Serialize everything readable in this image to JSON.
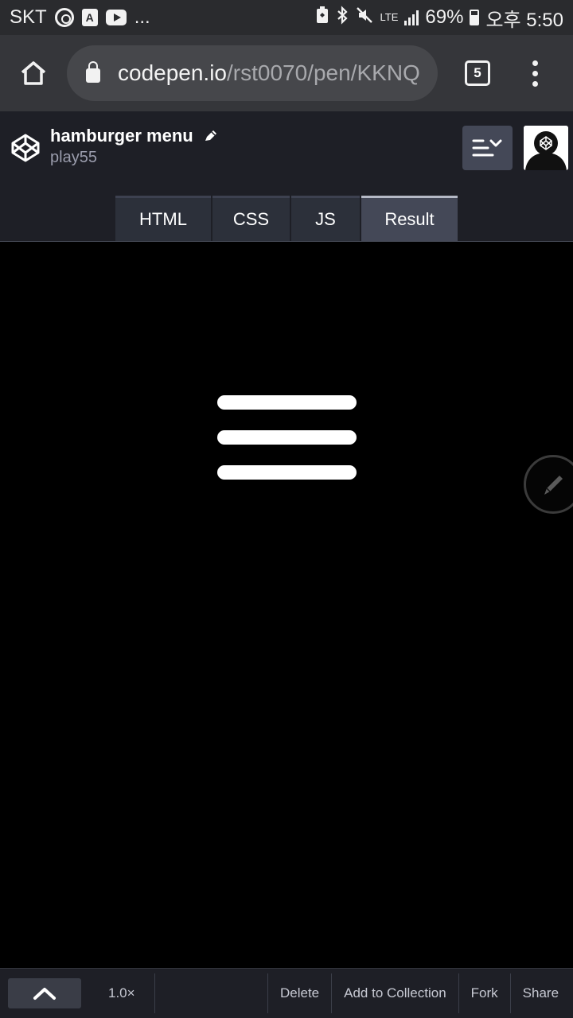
{
  "status_bar": {
    "carrier": "SKT",
    "more": "...",
    "network": "LTE",
    "battery": "69%",
    "time": "오후 5:50"
  },
  "browser": {
    "url_domain": "codepen.io",
    "url_path": "/rst0070/pen/KKNQ",
    "tab_count": "5"
  },
  "pen": {
    "title": "hamburger menu",
    "author": "play55"
  },
  "tabs": [
    {
      "label": "HTML",
      "active": false
    },
    {
      "label": "CSS",
      "active": false
    },
    {
      "label": "JS",
      "active": false
    },
    {
      "label": "Result",
      "active": true
    }
  ],
  "toolbar": {
    "zoom": "1.0×",
    "delete": "Delete",
    "add_to_collection": "Add to Collection",
    "fork": "Fork",
    "share": "Share"
  },
  "colors": {
    "header_bg": "#1e1f26",
    "tab_bg": "#2c303a",
    "tab_active_bg": "#444857",
    "result_bg": "#000000"
  }
}
